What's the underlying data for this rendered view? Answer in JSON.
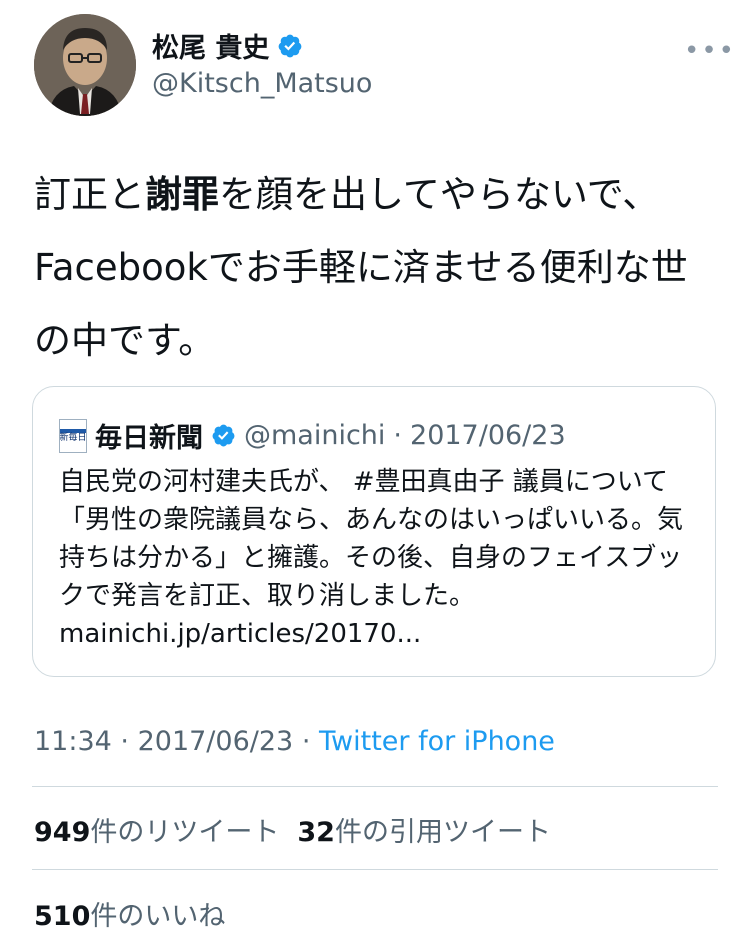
{
  "author": {
    "display_name": "松尾 貴史",
    "handle": "@Kitsch_Matsuo",
    "verified_icon": "verified-badge-icon",
    "avatar_icon": "profile-photo"
  },
  "more_icon": "more-horizontal-icon",
  "tweet": {
    "text_part1": "訂正と",
    "text_bold": "謝罪",
    "text_part2": "を顔を出してやらないで、Facebookでお手軽に済ませる便利な世の中です。"
  },
  "quoted_tweet": {
    "logo_text": "新毎日",
    "display_name": "毎日新聞",
    "handle": "@mainichi",
    "separator": "·",
    "date": "2017/06/23",
    "body": "自民党の河村建夫氏が、 #豊田真由子 議員について「男性の衆院議員なら、あんなのはいっぱいいる。気持ちは分かる」と擁護。その後、自身のフェイスブックで発言を訂正、取り消しました。",
    "link": "mainichi.jp/articles/20170..."
  },
  "meta": {
    "time": "11:34",
    "sep1": "·",
    "date": "2017/06/23",
    "sep2": "·",
    "source": "Twitter for iPhone"
  },
  "stats": {
    "retweets_count": "949",
    "retweets_label": "件のリツイート",
    "quotes_count": "32",
    "quotes_label": "件の引用ツイート",
    "likes_count": "510",
    "likes_label": "件のいいね"
  },
  "colors": {
    "accent": "#1d9bf0",
    "secondary_text": "#536471",
    "border": "#cfd9de"
  }
}
